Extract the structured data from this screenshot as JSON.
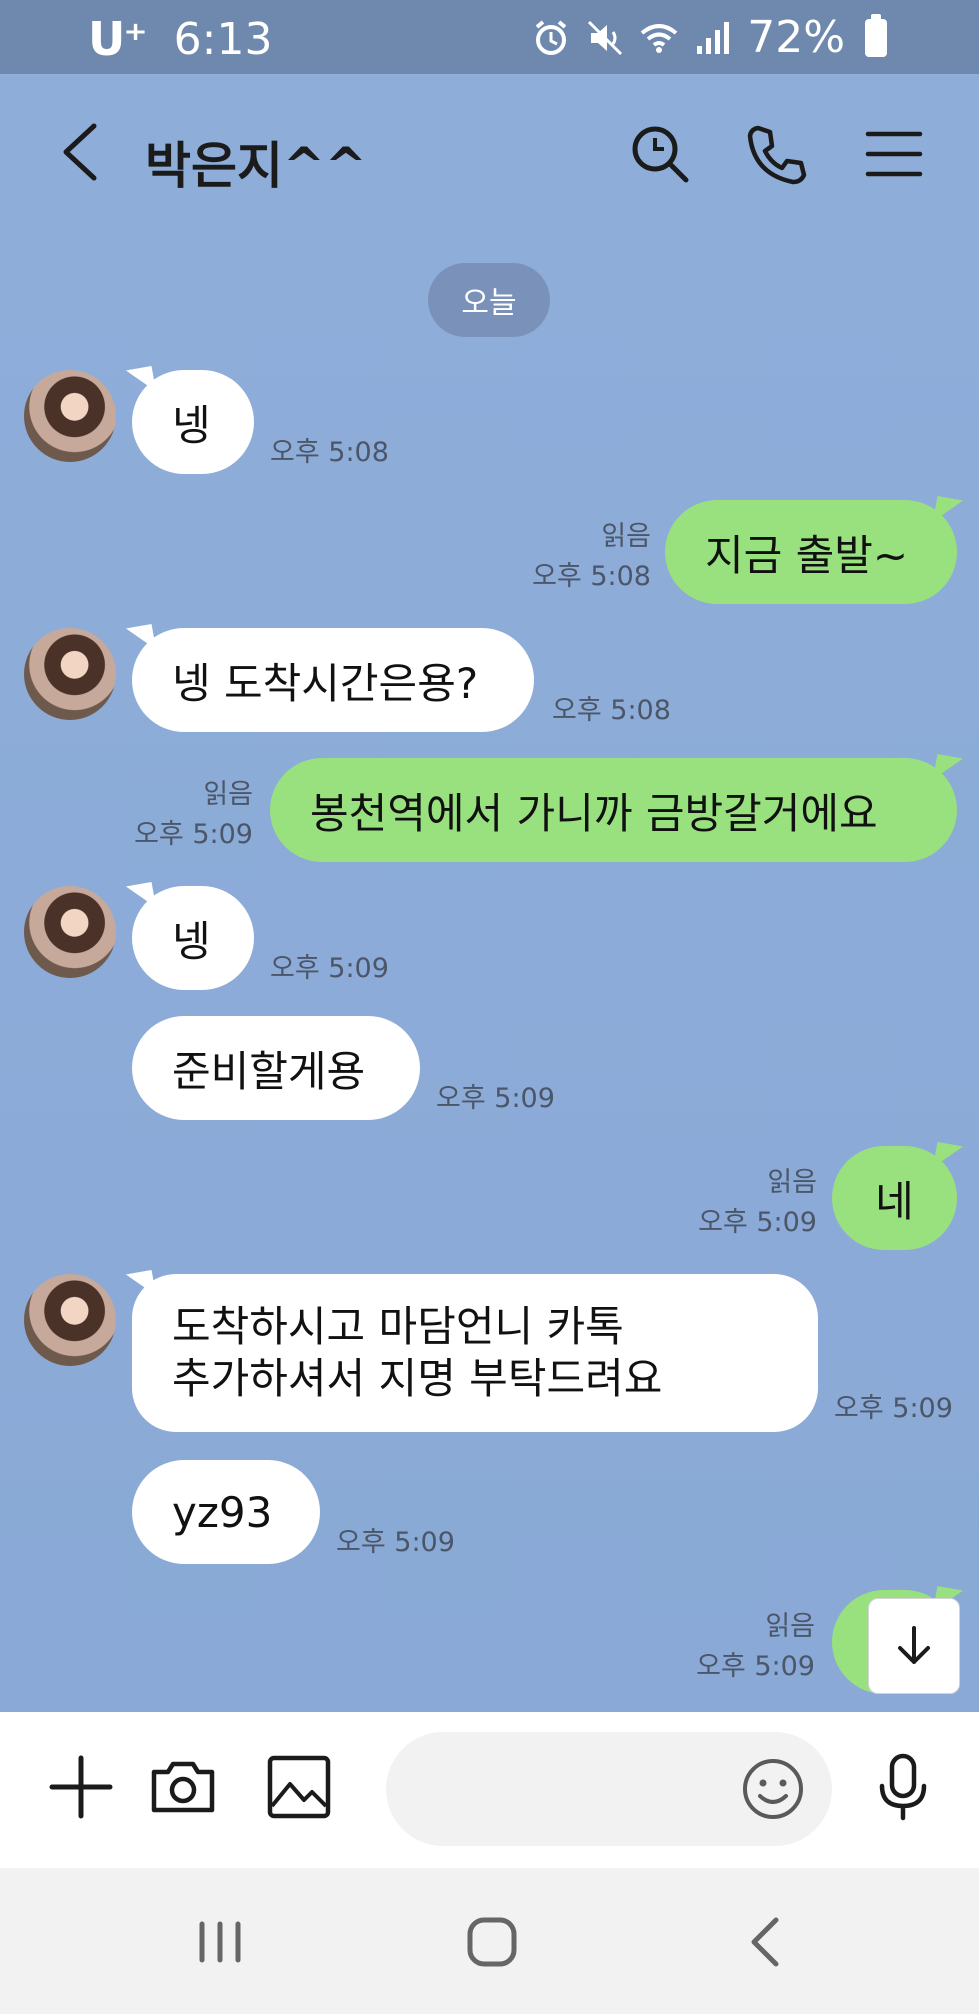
{
  "status_bar": {
    "carrier": "U⁺",
    "time": "6:13",
    "battery": "72%"
  },
  "header": {
    "title": "박은지^^"
  },
  "date_divider": "오늘",
  "messages": [
    {
      "text": "넹",
      "time": "오후 5:08"
    },
    {
      "text": "지금 출발~",
      "time": "오후 5:08",
      "read": "읽음"
    },
    {
      "text": "넹 도착시간은용?",
      "time": "오후 5:08"
    },
    {
      "text": "봉천역에서 가니까 금방갈거에요",
      "time": "오후 5:09",
      "read": "읽음"
    },
    {
      "text": "넹",
      "time": "오후 5:09"
    },
    {
      "text": "준비할게용",
      "time": "오후 5:09"
    },
    {
      "text": "네",
      "time": "오후 5:09",
      "read": "읽음"
    },
    {
      "line1": "도착하시고 마담언니 카톡",
      "line2": "추가하셔서 지명 부탁드려요",
      "time": "오후 5:09"
    },
    {
      "text": "yz93",
      "time": "오후 5:09"
    },
    {
      "time": "오후 5:09",
      "read": "읽음"
    }
  ],
  "input": {
    "placeholder": ""
  },
  "colors": {
    "chat_bg": "#8eadd9",
    "outgoing_bubble": "#99e07f",
    "incoming_bubble": "#ffffff",
    "status_bar": "#6f88ad"
  },
  "icons": [
    "back-icon",
    "search-icon",
    "phone-icon",
    "menu-icon",
    "plus-icon",
    "camera-icon",
    "image-icon",
    "emoji-icon",
    "mic-icon",
    "arrow-down-icon",
    "recents-icon",
    "home-icon",
    "back-nav-icon"
  ]
}
